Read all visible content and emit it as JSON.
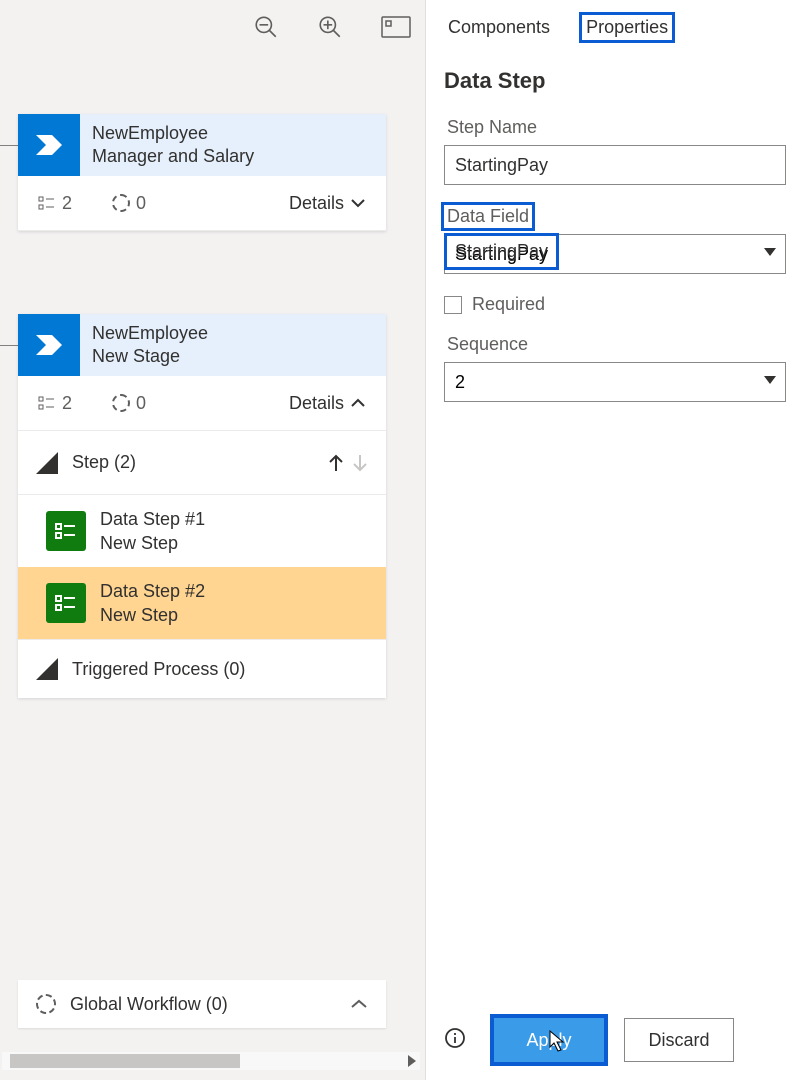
{
  "tabs": {
    "components": "Components",
    "properties": "Properties"
  },
  "properties": {
    "heading": "Data Step",
    "step_name_label": "Step Name",
    "step_name_value": "StartingPay",
    "data_field_label": "Data Field",
    "data_field_value": "StartingPay",
    "required_label": "Required",
    "sequence_label": "Sequence",
    "sequence_value": "2"
  },
  "footer": {
    "apply": "Apply",
    "discard": "Discard"
  },
  "stages": {
    "one": {
      "title1": "NewEmployee",
      "title2": "Manager and Salary",
      "step_count": "2",
      "other_count": "0",
      "details_label": "Details"
    },
    "two": {
      "title1": "NewEmployee",
      "title2": "New Stage",
      "step_count": "2",
      "other_count": "0",
      "details_label": "Details"
    }
  },
  "steps": {
    "header": "Step (2)",
    "ds1_title": "Data Step #1",
    "ds1_sub": "New Step",
    "ds2_title": "Data Step #2",
    "ds2_sub": "New Step",
    "triggered": "Triggered Process (0)"
  },
  "global_workflow": "Global Workflow (0)"
}
